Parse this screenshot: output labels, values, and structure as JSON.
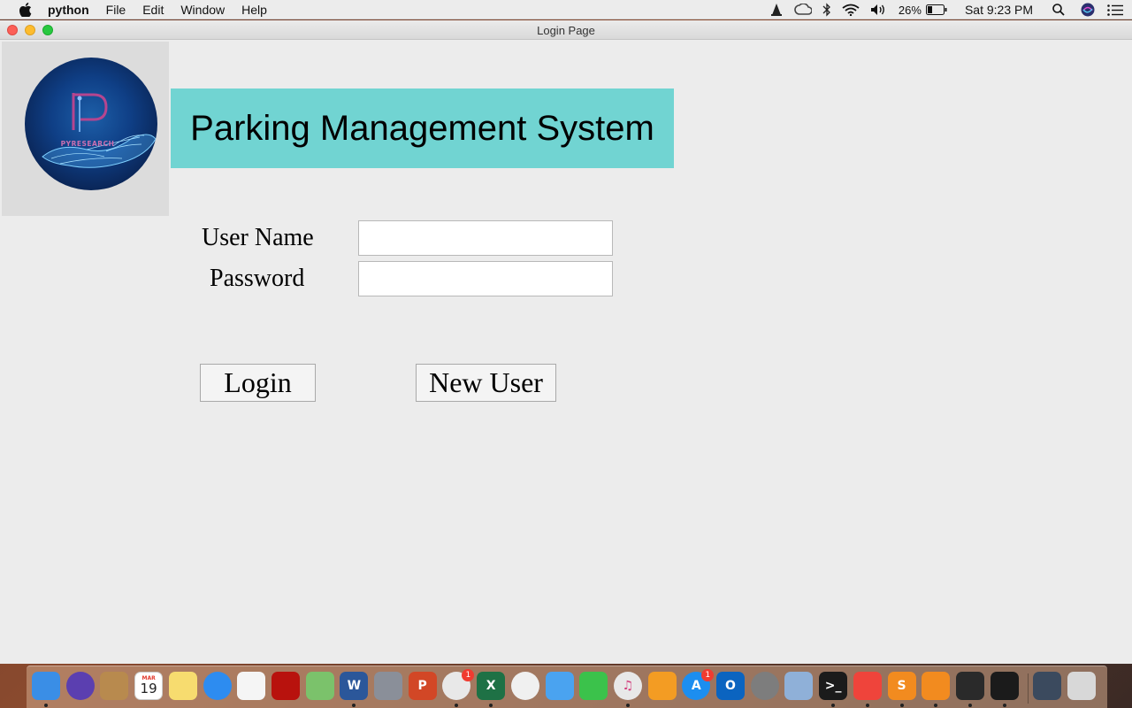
{
  "menubar": {
    "app_name": "python",
    "items": [
      "File",
      "Edit",
      "Window",
      "Help"
    ],
    "battery_percent": "26%",
    "clock": "Sat 9:23 PM",
    "status_icons": [
      "vlc-cone-icon",
      "creative-cloud-icon",
      "bluetooth-icon",
      "wifi-icon",
      "volume-icon",
      "battery-icon",
      "spotlight-search-icon",
      "siri-icon",
      "notification-center-icon"
    ]
  },
  "window": {
    "title": "Login Page"
  },
  "app": {
    "logo_text": "PYRESEARCH",
    "banner_title": "Parking Management System",
    "username_label": "User Name",
    "password_label": "Password",
    "username_value": "",
    "password_value": "",
    "login_button": "Login",
    "new_user_button": "New User"
  },
  "calendar_day": "19",
  "calendar_month": "MAR",
  "dock": {
    "apps": [
      {
        "name": "finder",
        "glyph": "",
        "color": "#3a8ee6",
        "running": true
      },
      {
        "name": "siri",
        "glyph": "",
        "color": "#5b3fb0",
        "running": false
      },
      {
        "name": "contacts",
        "glyph": "",
        "color": "#b88a4e",
        "running": false
      },
      {
        "name": "calendar",
        "glyph": "19",
        "color": "#ffffff",
        "running": false
      },
      {
        "name": "notes",
        "glyph": "",
        "color": "#f7dc6f",
        "running": false
      },
      {
        "name": "safari",
        "glyph": "",
        "color": "#2d8cf0",
        "running": false
      },
      {
        "name": "reminders",
        "glyph": "",
        "color": "#f5f5f5",
        "running": false
      },
      {
        "name": "acrobat",
        "glyph": "",
        "color": "#b8120d",
        "running": false
      },
      {
        "name": "maps",
        "glyph": "",
        "color": "#7bc26b",
        "running": false
      },
      {
        "name": "word",
        "glyph": "W",
        "color": "#2b579a",
        "running": true
      },
      {
        "name": "launchpad",
        "glyph": "",
        "color": "#8a8f99",
        "running": false
      },
      {
        "name": "powerpoint",
        "glyph": "P",
        "color": "#d24726",
        "running": false
      },
      {
        "name": "chrome",
        "glyph": "",
        "color": "#e8e8e8",
        "running": true,
        "badge": "1"
      },
      {
        "name": "excel",
        "glyph": "X",
        "color": "#1e7145",
        "running": true
      },
      {
        "name": "photos",
        "glyph": "",
        "color": "#f0f0f0",
        "running": false
      },
      {
        "name": "messages",
        "glyph": "",
        "color": "#4aa3f0",
        "running": false
      },
      {
        "name": "facetime",
        "glyph": "",
        "color": "#3bc24b",
        "running": false
      },
      {
        "name": "itunes",
        "glyph": "♫",
        "color": "#e8e8e8",
        "running": true
      },
      {
        "name": "ibooks",
        "glyph": "",
        "color": "#f39c23",
        "running": false
      },
      {
        "name": "app-store",
        "glyph": "A",
        "color": "#1c8ef0",
        "running": false,
        "badge": "1"
      },
      {
        "name": "outlook",
        "glyph": "O",
        "color": "#0b64c0",
        "running": false
      },
      {
        "name": "system-preferences",
        "glyph": "",
        "color": "#7d7d7d",
        "running": false
      },
      {
        "name": "preview",
        "glyph": "",
        "color": "#8fb0d8",
        "running": false
      },
      {
        "name": "terminal",
        "glyph": ">_",
        "color": "#1b1b1b",
        "running": true
      },
      {
        "name": "anydesk",
        "glyph": "",
        "color": "#ef443b",
        "running": true
      },
      {
        "name": "sublime-text",
        "glyph": "S",
        "color": "#f28b1f",
        "running": true
      },
      {
        "name": "vlc",
        "glyph": "",
        "color": "#f28b1f",
        "running": true
      },
      {
        "name": "filmora",
        "glyph": "",
        "color": "#2a2a2a",
        "running": true
      },
      {
        "name": "python-launcher",
        "glyph": "",
        "color": "#1b1b1b",
        "running": true
      },
      {
        "name": "downloads-stack",
        "glyph": "",
        "color": "#3b4a5e",
        "running": false
      },
      {
        "name": "trash",
        "glyph": "",
        "color": "#d8d8d8",
        "running": false
      }
    ]
  }
}
